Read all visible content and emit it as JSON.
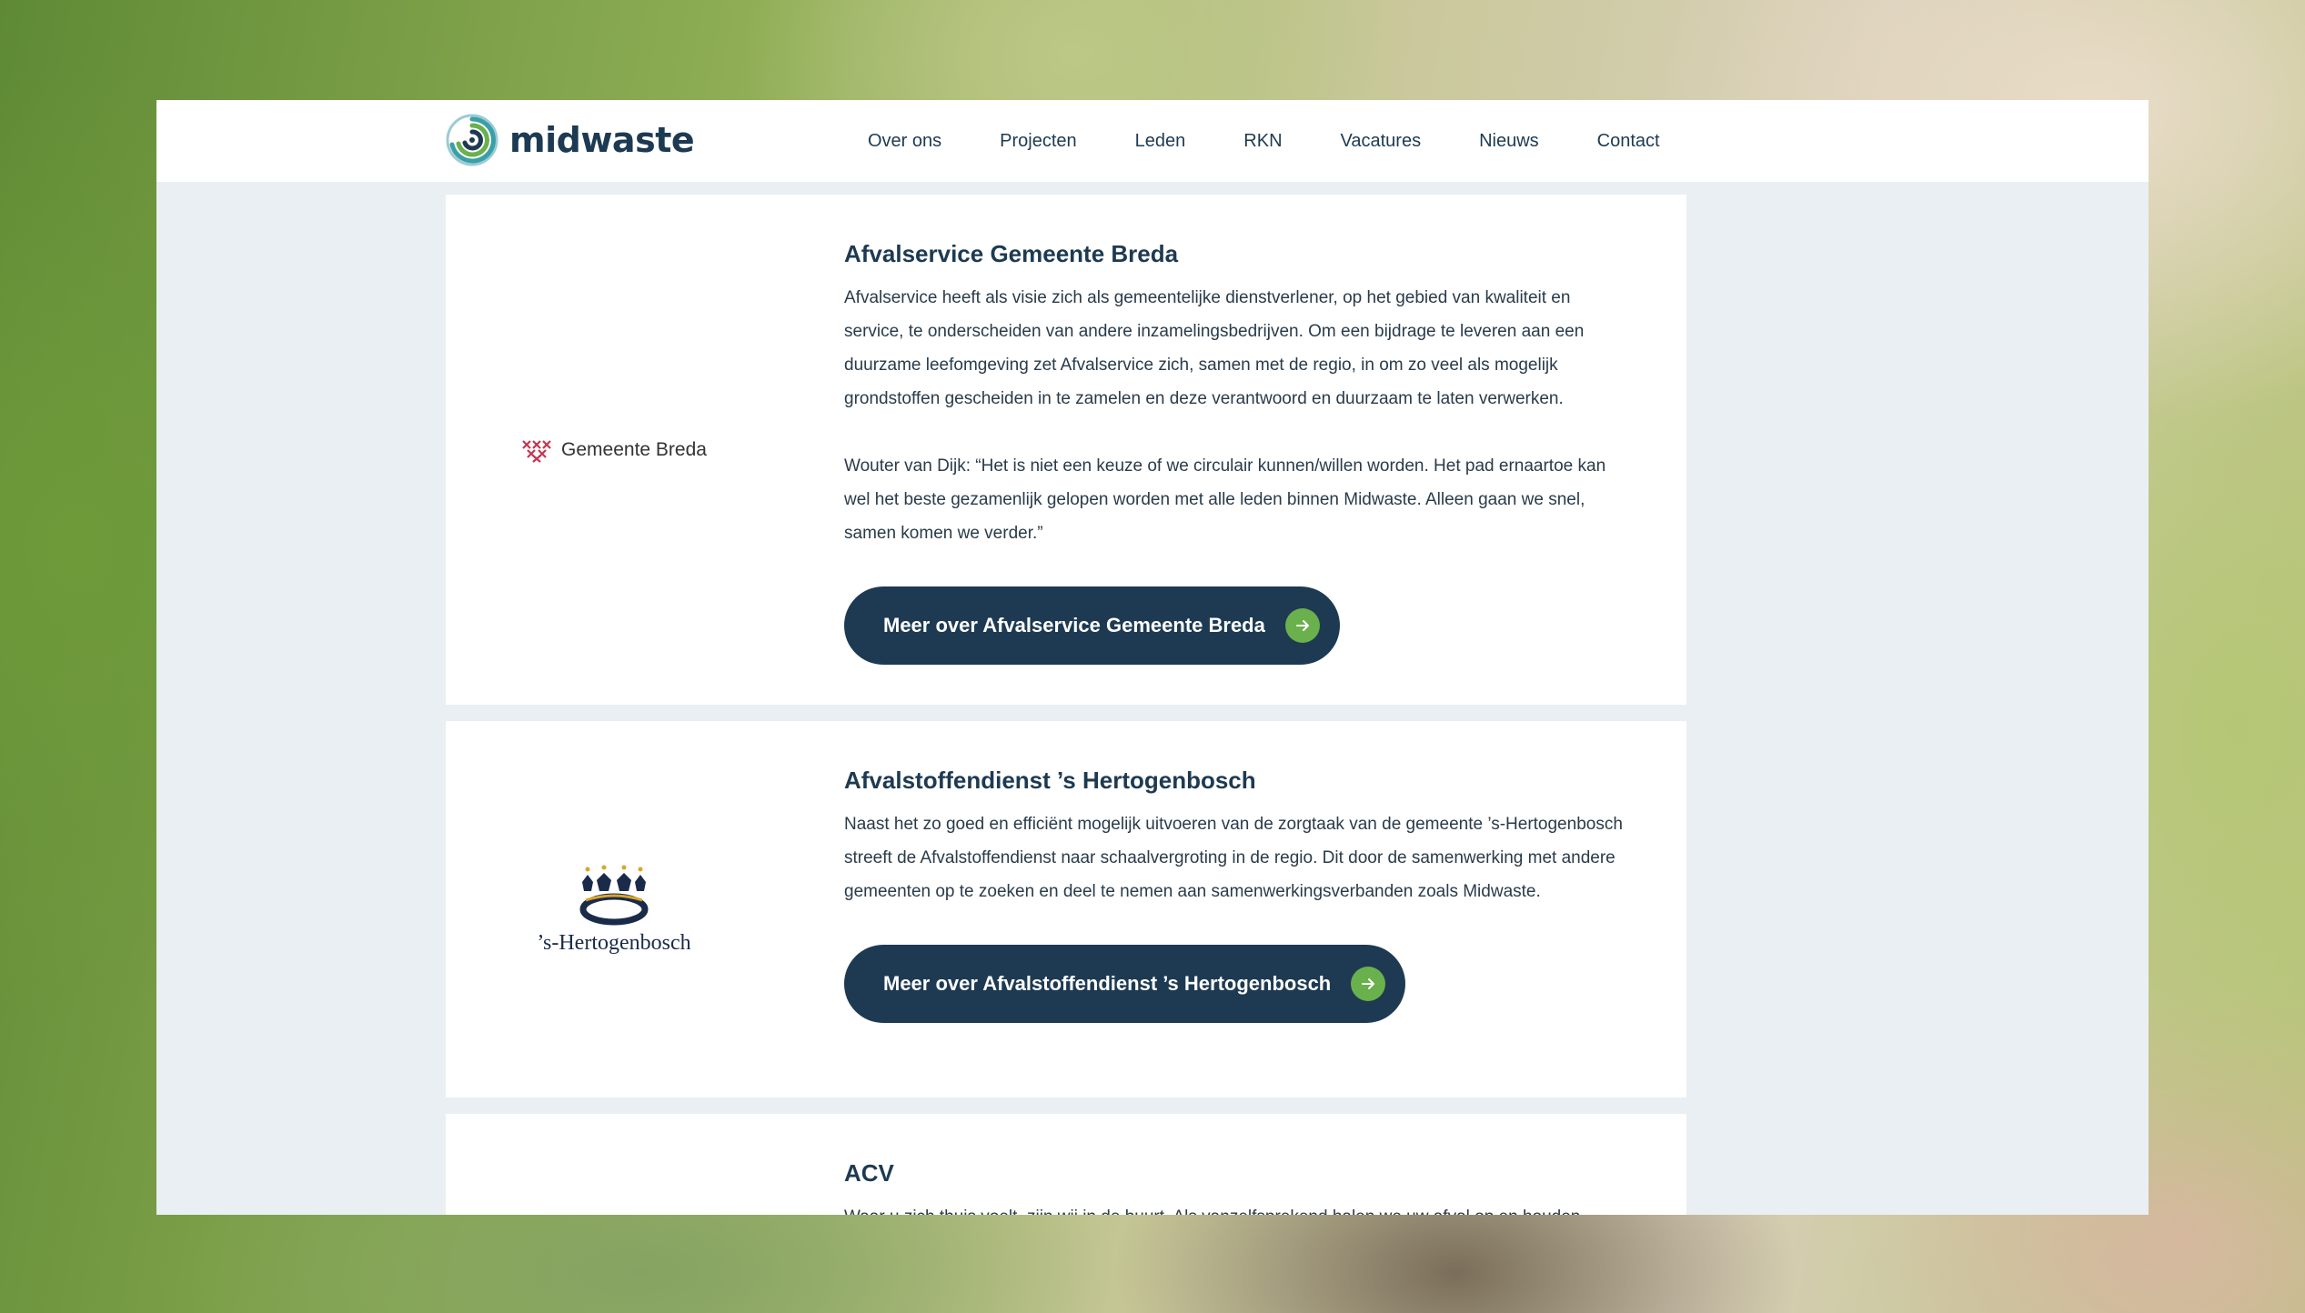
{
  "brand": {
    "name": "midwaste",
    "logo_icon": "swirl-logo-icon",
    "colors": {
      "navy": "#1d3a52",
      "green": "#6ab04c",
      "breda_red": "#c8344f",
      "hb_gold": "#d9a52a"
    }
  },
  "nav": {
    "items": [
      "Over ons",
      "Projecten",
      "Leden",
      "RKN",
      "Vacatures",
      "Nieuws",
      "Contact"
    ]
  },
  "members": [
    {
      "logo_text": "Gemeente Breda",
      "title": "Afvalservice Gemeente Breda",
      "paragraphs": [
        "Afvalservice heeft als visie zich als gemeentelijke dienstverlener, op het gebied van kwaliteit en service, te onderscheiden van andere inzamelingsbedrijven. Om een bijdrage te leveren aan een duurzame leefomgeving zet Afvalservice zich, samen met de regio, in om zo veel als mogelijk grondstoffen gescheiden in te zamelen en deze verantwoord en duurzaam te laten verwerken.",
        "Wouter van Dijk: “Het is niet een keuze of we circulair kunnen/willen worden. Het pad ernaartoe kan wel het beste gezamenlijk gelopen worden met alle leden binnen Midwaste. Alleen gaan we snel, samen komen we verder.”"
      ],
      "button": "Meer over Afvalservice Gemeente Breda"
    },
    {
      "logo_text": "’s-Hertogenbosch",
      "title": "Afvalstoffendienst ’s Hertogenbosch",
      "paragraphs": [
        "Naast het zo goed en efficiënt mogelijk uitvoeren van de zorgtaak van de gemeente ’s-Hertogenbosch streeft de Afvalstoffendienst naar schaalvergroting in de regio. Dit door de samenwerking met andere gemeenten op te zoeken en deel te nemen aan samenwerkingsverbanden zoals Midwaste."
      ],
      "button": "Meer over Afvalstoffendienst ’s Hertogenbosch"
    },
    {
      "title": "ACV",
      "paragraphs": [
        "Waar u zich thuis voelt, zijn wij in de buurt. Als vanzelfsprekend halen we uw afval op en houden"
      ]
    }
  ]
}
